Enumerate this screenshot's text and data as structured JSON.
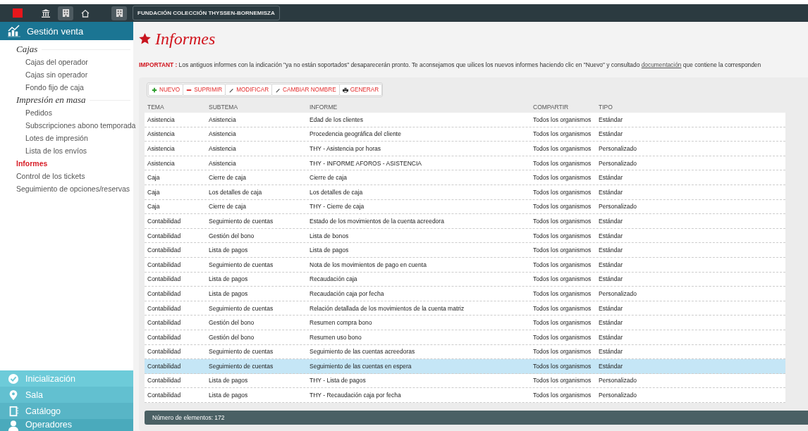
{
  "topbar": {
    "org": "FUNDACIÓN COLECCIÓN THYSSEN-BORNEMISZA"
  },
  "sidebar": {
    "module": "Gestión venta",
    "items": [
      {
        "kind": "group",
        "label": "Cajas"
      },
      {
        "kind": "sub",
        "label": "Cajas del operador",
        "selected": false
      },
      {
        "kind": "sub",
        "label": "Cajas sin operador",
        "selected": false
      },
      {
        "kind": "sub",
        "label": "Fondo fijo de caja",
        "selected": false
      },
      {
        "kind": "group",
        "label": "Impresión en masa"
      },
      {
        "kind": "sub",
        "label": "Pedidos",
        "selected": false
      },
      {
        "kind": "sub",
        "label": "Subscripciones abono temporada",
        "selected": false
      },
      {
        "kind": "sub",
        "label": "Lotes de impresión",
        "selected": false
      },
      {
        "kind": "sub",
        "label": "Lista de los envíos",
        "selected": false
      },
      {
        "kind": "top",
        "label": "Informes",
        "selected": true
      },
      {
        "kind": "top",
        "label": "Control de los tickets",
        "selected": false
      },
      {
        "kind": "top",
        "label": "Seguimiento de opciones/reservas",
        "selected": false
      }
    ],
    "sections": [
      {
        "kind": "check",
        "label": "Inicialización"
      },
      {
        "kind": "pin",
        "label": "Sala"
      },
      {
        "kind": "book",
        "label": "Catálogo"
      },
      {
        "kind": "person",
        "label": "Operadores"
      }
    ]
  },
  "page": {
    "title": "Informes",
    "notice": "**IMPORTANT :** Los antiguos informes con la indicación \"ya no están soportados\" desaparecerán pronto. Te aconsejamos que uilices los nuevos informes haciendo clic en \"Nuevo\" y consultado",
    "notice_link": "documentación",
    "notice_tail": "que contiene la corresponden"
  },
  "toolbar": [
    {
      "kind": "plus",
      "label": "NUEVO"
    },
    {
      "kind": "minus",
      "label": "SUPRIMIR"
    },
    {
      "kind": "pencil",
      "label": "MODIFICAR"
    },
    {
      "kind": "pencil",
      "label": "CAMBIAR NOMBRE"
    },
    {
      "kind": "printer",
      "label": "GENERAR"
    }
  ],
  "table": {
    "columns": [
      "TEMA",
      "SUBTEMA",
      "INFORME",
      "COMPARTIR",
      "TIPO"
    ],
    "rows": [
      {
        "cells": [
          "Asistencia",
          "Asistencia",
          "Edad de los clientes",
          "Todos los organismos",
          "Estándar"
        ],
        "selected": false
      },
      {
        "cells": [
          "Asistencia",
          "Asistencia",
          "Procedencia geográfica del cliente",
          "Todos los organismos",
          "Estándar"
        ],
        "selected": false
      },
      {
        "cells": [
          "Asistencia",
          "Asistencia",
          "THY - Asistencia por horas",
          "Todos los organismos",
          "Personalizado"
        ],
        "selected": false
      },
      {
        "cells": [
          "Asistencia",
          "Asistencia",
          "THY - INFORME AFOROS - ASISTENCIA",
          "Todos los organismos",
          "Personalizado"
        ],
        "selected": false
      },
      {
        "cells": [
          "Caja",
          "Cierre de caja",
          "Cierre de caja",
          "Todos los organismos",
          "Estándar"
        ],
        "selected": false
      },
      {
        "cells": [
          "Caja",
          "Los detalles de caja",
          "Los detalles de caja",
          "Todos los organismos",
          "Estándar"
        ],
        "selected": false
      },
      {
        "cells": [
          "Caja",
          "Cierre de caja",
          "THY - Cierre de caja",
          "Todos los organismos",
          "Personalizado"
        ],
        "selected": false
      },
      {
        "cells": [
          "Contabilidad",
          "Seguimiento de cuentas",
          "Estado de los movimientos de la cuenta acreedora",
          "Todos los organismos",
          "Estándar"
        ],
        "selected": false
      },
      {
        "cells": [
          "Contabilidad",
          "Gestión del bono",
          "Lista de bonos",
          "Todos los organismos",
          "Estándar"
        ],
        "selected": false
      },
      {
        "cells": [
          "Contabilidad",
          "Lista de pagos",
          "Lista de pagos",
          "Todos los organismos",
          "Estándar"
        ],
        "selected": false
      },
      {
        "cells": [
          "Contabilidad",
          "Seguimiento de cuentas",
          "Nota de los movimientos de pago en cuenta",
          "Todos los organismos",
          "Estándar"
        ],
        "selected": false
      },
      {
        "cells": [
          "Contabilidad",
          "Lista de pagos",
          "Recaudación caja",
          "Todos los organismos",
          "Estándar"
        ],
        "selected": false
      },
      {
        "cells": [
          "Contabilidad",
          "Lista de pagos",
          "Recaudación caja por fecha",
          "Todos los organismos",
          "Personalizado"
        ],
        "selected": false
      },
      {
        "cells": [
          "Contabilidad",
          "Seguimiento de cuentas",
          "Relación detallada de los movimientos de la cuenta matriz",
          "Todos los organismos",
          "Estándar"
        ],
        "selected": false
      },
      {
        "cells": [
          "Contabilidad",
          "Gestión del bono",
          "Resumen compra bono",
          "Todos los organismos",
          "Estándar"
        ],
        "selected": false
      },
      {
        "cells": [
          "Contabilidad",
          "Gestión del bono",
          "Resumen uso bono",
          "Todos los organismos",
          "Estándar"
        ],
        "selected": false
      },
      {
        "cells": [
          "Contabilidad",
          "Seguimiento de cuentas",
          "Seguimiento de las cuentas acreedoras",
          "Todos los organismos",
          "Estándar"
        ],
        "selected": false
      },
      {
        "cells": [
          "Contabilidad",
          "Seguimiento de cuentas",
          "Seguimiento de las cuentas en espera",
          "Todos los organismos",
          "Estándar"
        ],
        "selected": true
      },
      {
        "cells": [
          "Contabilidad",
          "Lista de pagos",
          "THY - Lista de pagos",
          "Todos los organismos",
          "Personalizado"
        ],
        "selected": false
      },
      {
        "cells": [
          "Contabilidad",
          "Lista de pagos",
          "THY - Recaudación caja por fecha",
          "Todos los organismos",
          "Personalizado"
        ],
        "selected": false
      }
    ]
  },
  "status_bar": "Número de elementos: 172"
}
